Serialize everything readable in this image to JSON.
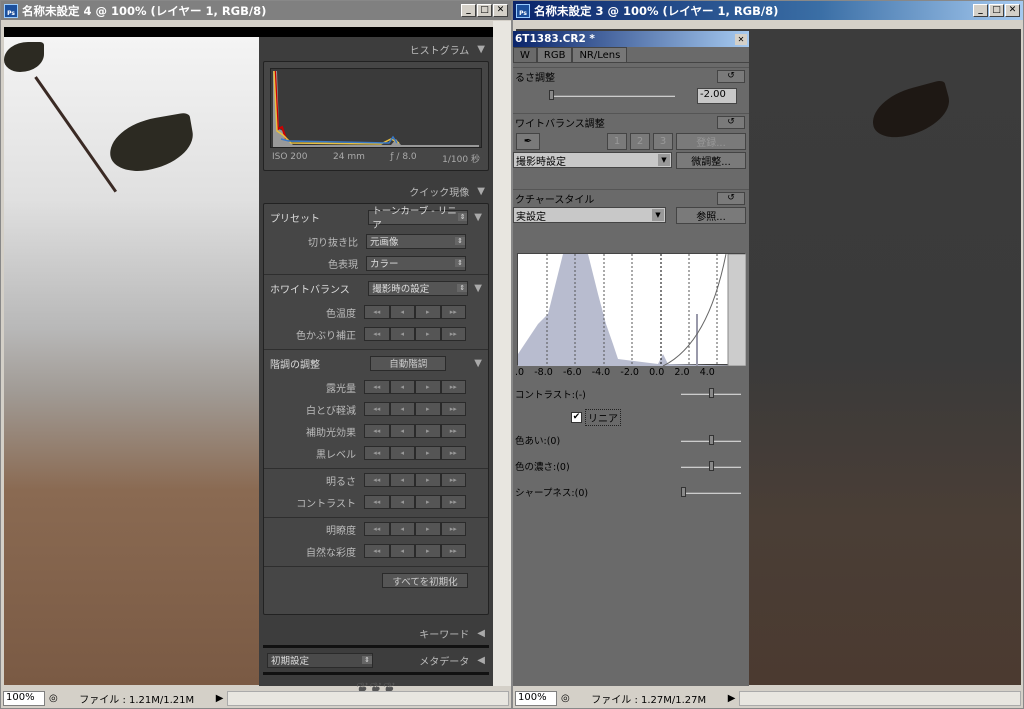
{
  "left_window": {
    "title": "名称未設定 4 @ 100% (レイヤー 1, RGB/8)",
    "zoom": "100%",
    "file_info": "ファイル : 1.21M/1.21M",
    "panel": {
      "histogram_title": "ヒストグラム",
      "exif": {
        "iso": "ISO 200",
        "focal": "24 mm",
        "aperture": "ƒ / 8.0",
        "shutter": "1/100 秒"
      },
      "quick_develop_title": "クイック現像",
      "preset_label": "プリセット",
      "preset_value": "トーンカーブ - リニア",
      "crop_label": "切り抜き比",
      "crop_value": "元画像",
      "color_label": "色表現",
      "color_value": "カラー",
      "wb_label": "ホワイトバランス",
      "wb_value": "撮影時の設定",
      "wb_rows": [
        "色温度",
        "色かぶり補正"
      ],
      "tone_label": "階調の調整",
      "auto_tone": "自動階調",
      "tone_rows": [
        "露光量",
        "白とび軽減",
        "補助光効果",
        "黒レベル"
      ],
      "tone_rows2": [
        "明るさ",
        "コントラスト"
      ],
      "tone_rows3": [
        "明瞭度",
        "自然な彩度"
      ],
      "reset_all": "すべてを初期化",
      "keyword_title": "キーワード",
      "metadata_title": "メタデータ",
      "metadata_preset": "初期設定"
    }
  },
  "right_window": {
    "title": "名称未設定 3 @ 100% (レイヤー 1, RGB/8)",
    "zoom": "100%",
    "file_info": "ファイル : 1.27M/1.27M",
    "dialog": {
      "title": "6T1383.CR2 *",
      "tabs": [
        "W",
        "RGB",
        "NR/Lens"
      ],
      "brightness_title": "るさ調整",
      "brightness_value": "-2.00",
      "wb_title": "ワイトバランス調整",
      "wb_slots": [
        "1",
        "2",
        "3"
      ],
      "register": "登録...",
      "wb_value": "撮影時設定",
      "fine_tune": "微調整...",
      "picture_style_title": "クチャースタイル",
      "picture_style_value": "実設定",
      "browse": "参照...",
      "axis": [
        ".0",
        "-8.0",
        "-6.0",
        "-4.0",
        "-2.0",
        "0.0",
        "2.0",
        "4.0"
      ],
      "contrast": "コントラスト:(-)",
      "linear": "リニア",
      "linear_checked": true,
      "hue": "色あい:(0)",
      "saturation": "色の濃さ:(0)",
      "sharpness": "シャープネス:(0)"
    }
  }
}
